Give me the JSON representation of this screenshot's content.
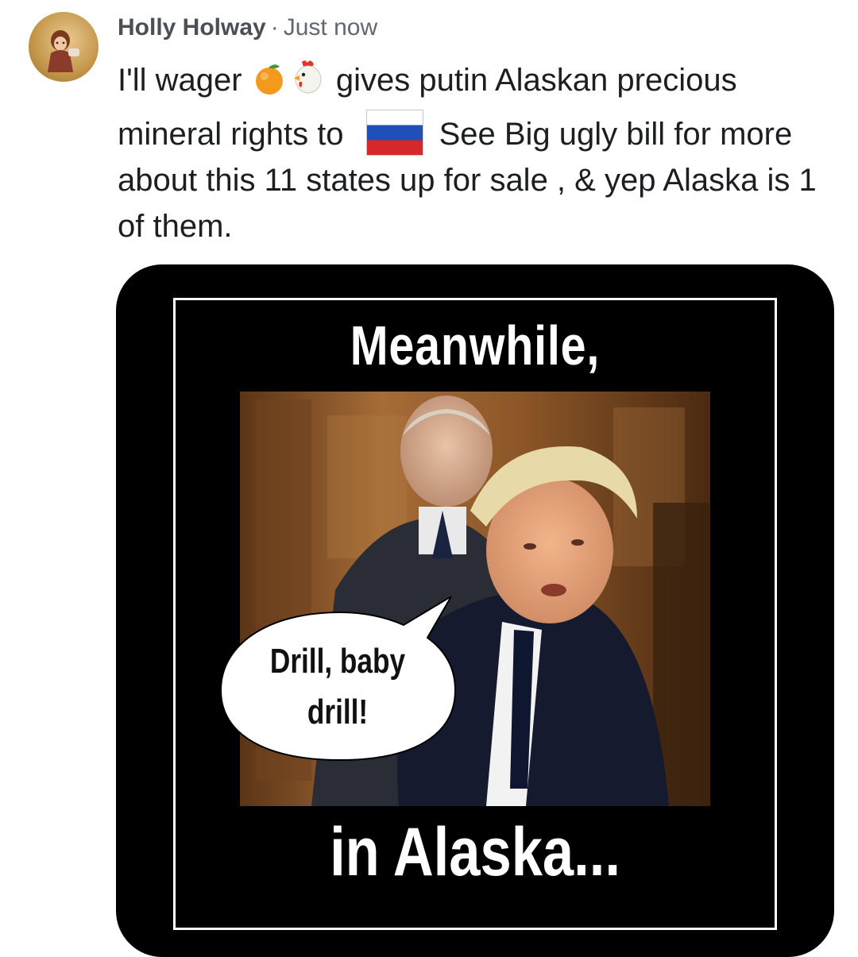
{
  "post": {
    "author": "Holly Holway",
    "separator": "·",
    "timestamp": "Just now",
    "avatar_icon": "avatar-doll-image",
    "text_parts": {
      "part1": "I'll wager",
      "emoji1": "orange-emoji",
      "emoji2": "chicken-emoji",
      "part2": "gives putin Alaskan precious mineral rights to",
      "flag": "russia-flag-emoji",
      "part3": "See Big ugly bill for more about this 11 states up for sale , & yep Alaska is 1 of them."
    }
  },
  "meme": {
    "top_caption": "Meanwhile,",
    "speech_bubble": "Drill, baby drill!",
    "bottom_caption": "in Alaska..."
  },
  "colors": {
    "meta_text": "#606770",
    "body_text": "#1c1e21",
    "meme_bg": "#000000",
    "flag_white": "#ffffff",
    "flag_blue": "#1f4fb8",
    "flag_red": "#d62828"
  }
}
